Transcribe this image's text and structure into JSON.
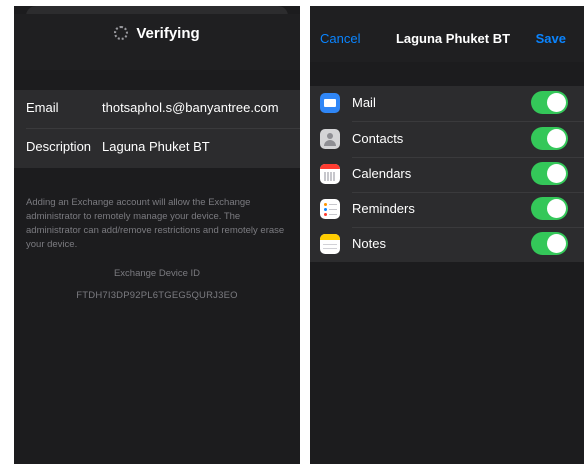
{
  "left_screen": {
    "header": {
      "title": "Verifying"
    },
    "fields": [
      {
        "label": "Email",
        "value": "thotsaphol.s@banyantree.com"
      },
      {
        "label": "Description",
        "value": "Laguna Phuket BT"
      }
    ],
    "description_text": "Adding an Exchange account will allow the Exchange administrator to remotely manage your device. The administrator can add/remove restrictions and remotely erase your device.",
    "device_id_title": "Exchange Device ID",
    "device_id_value": "FTDH7I3DP92PL6TGEG5QURJ3EO"
  },
  "right_screen": {
    "header": {
      "cancel_label": "Cancel",
      "title": "Laguna Phuket BT",
      "save_label": "Save"
    },
    "sync_items": [
      {
        "label": "Mail",
        "icon": "mail-icon",
        "enabled": true
      },
      {
        "label": "Contacts",
        "icon": "contacts-icon",
        "enabled": true
      },
      {
        "label": "Calendars",
        "icon": "calendar-icon",
        "enabled": true
      },
      {
        "label": "Reminders",
        "icon": "reminders-icon",
        "enabled": true
      },
      {
        "label": "Notes",
        "icon": "notes-icon",
        "enabled": true
      }
    ]
  },
  "colors": {
    "accent": "#0a84ff",
    "toggle_on": "#34c759",
    "background": "#1c1c1e",
    "group": "#2c2c2e"
  }
}
